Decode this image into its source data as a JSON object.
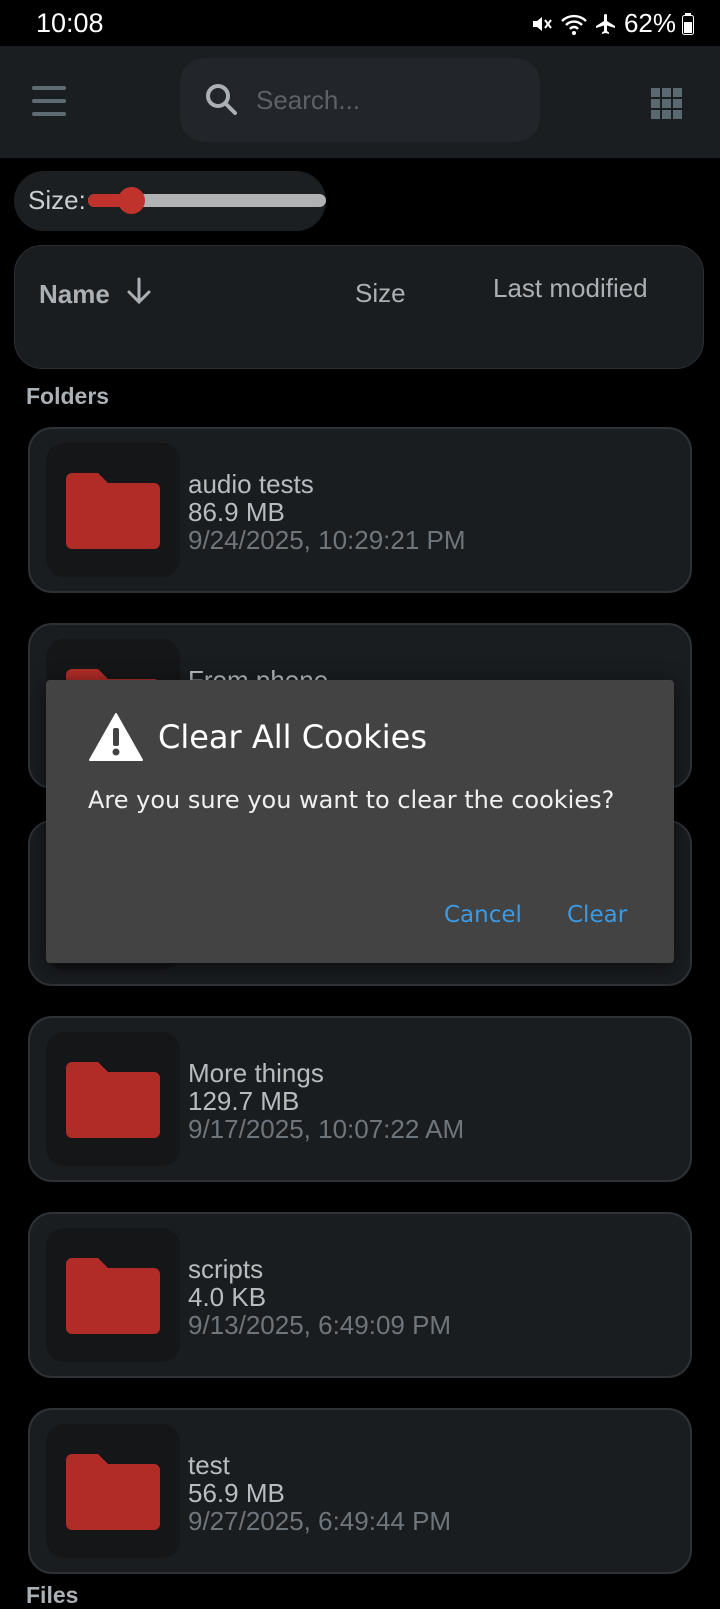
{
  "status_bar": {
    "time": "10:08",
    "battery": "62%"
  },
  "search": {
    "placeholder": "Search..."
  },
  "size_control": {
    "label": "Size:",
    "value_fraction": 0.18
  },
  "columns": {
    "name": "Name",
    "size": "Size",
    "last_modified": "Last modified"
  },
  "sections": {
    "folders": "Folders",
    "files": "Files"
  },
  "folders": [
    {
      "name": "audio tests",
      "size": "86.9 MB",
      "modified": "9/24/2025, 10:29:21 PM"
    },
    {
      "name": "From phone",
      "size": "",
      "modified": ""
    },
    {
      "name": "",
      "size": "",
      "modified": ""
    },
    {
      "name": "More things",
      "size": "129.7 MB",
      "modified": "9/17/2025, 10:07:22 AM"
    },
    {
      "name": "scripts",
      "size": "4.0 KB",
      "modified": "9/13/2025, 6:49:09 PM"
    },
    {
      "name": "test",
      "size": "56.9 MB",
      "modified": "9/27/2025, 6:49:44 PM"
    }
  ],
  "dialog": {
    "title": "Clear All Cookies",
    "message": "Are you sure you want to clear the cookies?",
    "cancel_label": "Cancel",
    "confirm_label": "Clear"
  },
  "colors": {
    "accent": "#c0322c",
    "dialog_button": "#3a9ae6"
  }
}
